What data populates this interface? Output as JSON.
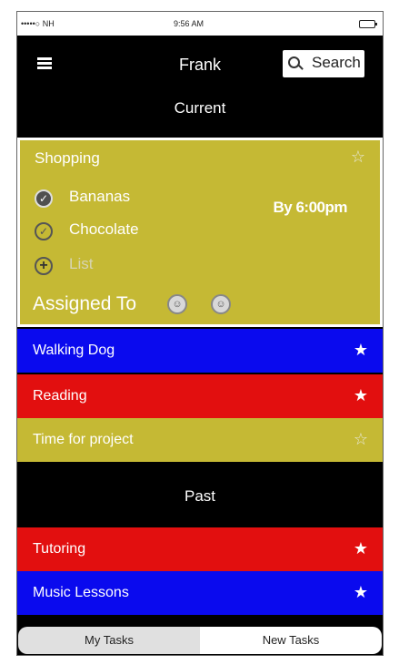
{
  "status_bar": {
    "carrier": "•••••○ NH",
    "time": "9:56 AM"
  },
  "header": {
    "title": "Frank",
    "search_label": "Search"
  },
  "sections": {
    "current": "Current",
    "past": "Past"
  },
  "expanded_task": {
    "title": "Shopping",
    "items": [
      {
        "label": "Bananas",
        "state": "checked"
      },
      {
        "label": "Chocolate",
        "state": "checked-outline"
      },
      {
        "label": "List",
        "state": "add"
      }
    ],
    "deadline": "By 6:00pm",
    "assigned_label": "Assigned To"
  },
  "current_tasks": [
    {
      "label": "Walking Dog",
      "color": "#0a0aee"
    },
    {
      "label": "Reading",
      "color": "#e20f0f"
    },
    {
      "label": "Time for project",
      "color": "#c5b934"
    }
  ],
  "past_tasks": [
    {
      "label": "Tutoring",
      "color": "#e20f0f"
    },
    {
      "label": "Music Lessons",
      "color": "#0a0aee"
    }
  ],
  "tabs": {
    "my_tasks": "My Tasks",
    "new_tasks": "New Tasks"
  },
  "icons": {
    "star": "star-icon",
    "menu": "hamburger-menu-icon",
    "search": "search-icon"
  }
}
